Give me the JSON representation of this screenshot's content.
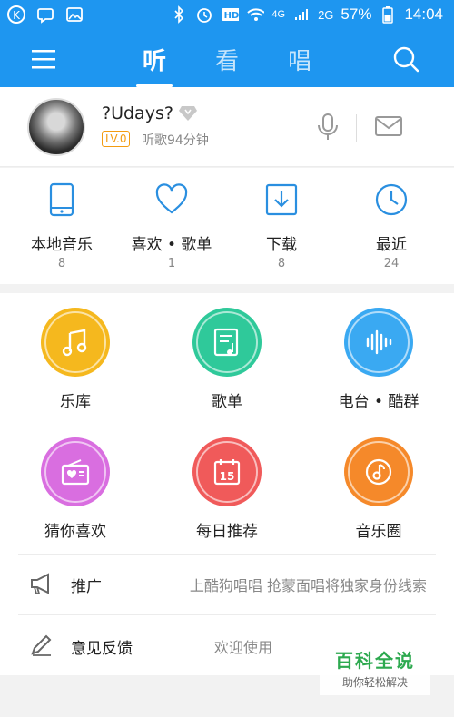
{
  "statusbar": {
    "network": "4G",
    "network2": "2G",
    "battery": "57%",
    "time": "14:04",
    "icons": [
      "kugou-icon",
      "chat-icon",
      "image-icon",
      "bluetooth-icon",
      "alarm-icon",
      "hd-icon",
      "wifi-icon",
      "signal-icon",
      "battery-icon"
    ]
  },
  "nav": {
    "tabs": [
      "听",
      "看",
      "唱"
    ],
    "active_tab": 0
  },
  "profile": {
    "username": "?Udays?",
    "level": "LV.0",
    "listen_time": "听歌94分钟"
  },
  "quick": [
    {
      "label": "本地音乐",
      "count": "8"
    },
    {
      "label": "喜欢 • 歌单",
      "count": "1"
    },
    {
      "label": "下载",
      "count": "8"
    },
    {
      "label": "最近",
      "count": "24"
    }
  ],
  "grid": [
    {
      "label": "乐库",
      "color": "#f5b81e"
    },
    {
      "label": "歌单",
      "color": "#2fc99a"
    },
    {
      "label": "电台 • 酷群",
      "color": "#3aa9f2"
    },
    {
      "label": "猜你喜欢",
      "color": "#d96ee0"
    },
    {
      "label": "每日推荐",
      "color": "#f05a5a"
    },
    {
      "label": "音乐圈",
      "color": "#f5892a"
    }
  ],
  "rows": [
    {
      "label": "推广",
      "desc": "上酷狗唱唱 抢蒙面唱将独家身份线索"
    },
    {
      "label": "意见反馈",
      "desc": "欢迎使用"
    }
  ],
  "watermark": {
    "title": "百科全说",
    "subtitle": "助你轻松解决"
  },
  "colors": {
    "brand": "#1e96f0",
    "accent_icon": "#2a8fe0"
  }
}
